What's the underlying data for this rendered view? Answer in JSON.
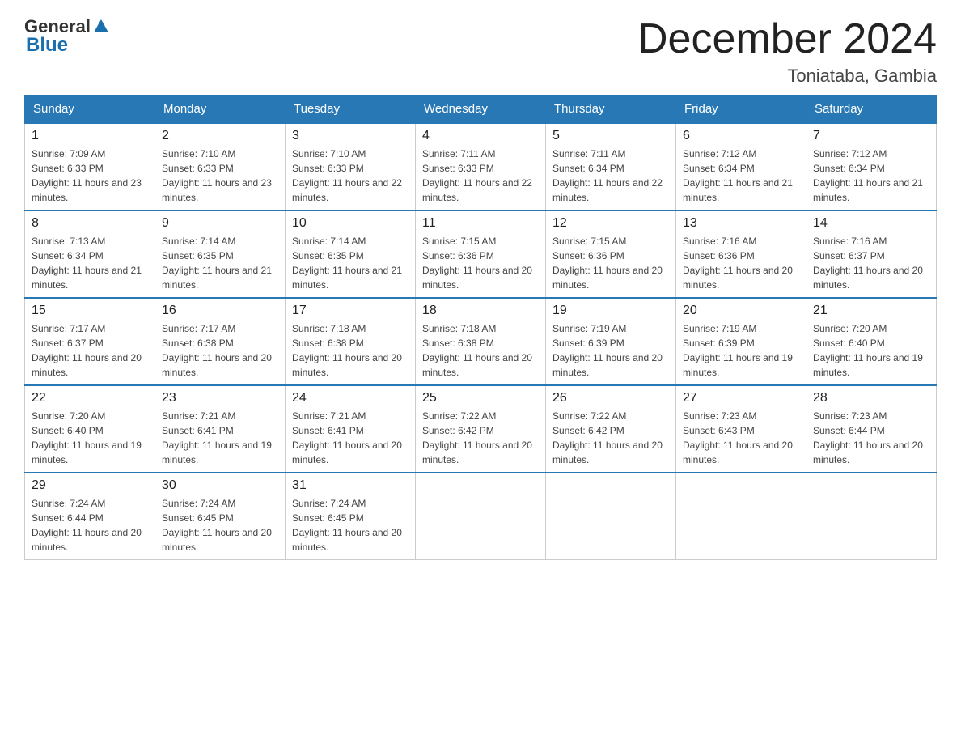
{
  "header": {
    "logo_text_general": "General",
    "logo_text_blue": "Blue",
    "month_title": "December 2024",
    "location": "Toniataba, Gambia"
  },
  "days_of_week": [
    "Sunday",
    "Monday",
    "Tuesday",
    "Wednesday",
    "Thursday",
    "Friday",
    "Saturday"
  ],
  "weeks": [
    [
      {
        "day": "1",
        "sunrise": "7:09 AM",
        "sunset": "6:33 PM",
        "daylight": "11 hours and 23 minutes."
      },
      {
        "day": "2",
        "sunrise": "7:10 AM",
        "sunset": "6:33 PM",
        "daylight": "11 hours and 23 minutes."
      },
      {
        "day": "3",
        "sunrise": "7:10 AM",
        "sunset": "6:33 PM",
        "daylight": "11 hours and 22 minutes."
      },
      {
        "day": "4",
        "sunrise": "7:11 AM",
        "sunset": "6:33 PM",
        "daylight": "11 hours and 22 minutes."
      },
      {
        "day": "5",
        "sunrise": "7:11 AM",
        "sunset": "6:34 PM",
        "daylight": "11 hours and 22 minutes."
      },
      {
        "day": "6",
        "sunrise": "7:12 AM",
        "sunset": "6:34 PM",
        "daylight": "11 hours and 21 minutes."
      },
      {
        "day": "7",
        "sunrise": "7:12 AM",
        "sunset": "6:34 PM",
        "daylight": "11 hours and 21 minutes."
      }
    ],
    [
      {
        "day": "8",
        "sunrise": "7:13 AM",
        "sunset": "6:34 PM",
        "daylight": "11 hours and 21 minutes."
      },
      {
        "day": "9",
        "sunrise": "7:14 AM",
        "sunset": "6:35 PM",
        "daylight": "11 hours and 21 minutes."
      },
      {
        "day": "10",
        "sunrise": "7:14 AM",
        "sunset": "6:35 PM",
        "daylight": "11 hours and 21 minutes."
      },
      {
        "day": "11",
        "sunrise": "7:15 AM",
        "sunset": "6:36 PM",
        "daylight": "11 hours and 20 minutes."
      },
      {
        "day": "12",
        "sunrise": "7:15 AM",
        "sunset": "6:36 PM",
        "daylight": "11 hours and 20 minutes."
      },
      {
        "day": "13",
        "sunrise": "7:16 AM",
        "sunset": "6:36 PM",
        "daylight": "11 hours and 20 minutes."
      },
      {
        "day": "14",
        "sunrise": "7:16 AM",
        "sunset": "6:37 PM",
        "daylight": "11 hours and 20 minutes."
      }
    ],
    [
      {
        "day": "15",
        "sunrise": "7:17 AM",
        "sunset": "6:37 PM",
        "daylight": "11 hours and 20 minutes."
      },
      {
        "day": "16",
        "sunrise": "7:17 AM",
        "sunset": "6:38 PM",
        "daylight": "11 hours and 20 minutes."
      },
      {
        "day": "17",
        "sunrise": "7:18 AM",
        "sunset": "6:38 PM",
        "daylight": "11 hours and 20 minutes."
      },
      {
        "day": "18",
        "sunrise": "7:18 AM",
        "sunset": "6:38 PM",
        "daylight": "11 hours and 20 minutes."
      },
      {
        "day": "19",
        "sunrise": "7:19 AM",
        "sunset": "6:39 PM",
        "daylight": "11 hours and 20 minutes."
      },
      {
        "day": "20",
        "sunrise": "7:19 AM",
        "sunset": "6:39 PM",
        "daylight": "11 hours and 19 minutes."
      },
      {
        "day": "21",
        "sunrise": "7:20 AM",
        "sunset": "6:40 PM",
        "daylight": "11 hours and 19 minutes."
      }
    ],
    [
      {
        "day": "22",
        "sunrise": "7:20 AM",
        "sunset": "6:40 PM",
        "daylight": "11 hours and 19 minutes."
      },
      {
        "day": "23",
        "sunrise": "7:21 AM",
        "sunset": "6:41 PM",
        "daylight": "11 hours and 19 minutes."
      },
      {
        "day": "24",
        "sunrise": "7:21 AM",
        "sunset": "6:41 PM",
        "daylight": "11 hours and 20 minutes."
      },
      {
        "day": "25",
        "sunrise": "7:22 AM",
        "sunset": "6:42 PM",
        "daylight": "11 hours and 20 minutes."
      },
      {
        "day": "26",
        "sunrise": "7:22 AM",
        "sunset": "6:42 PM",
        "daylight": "11 hours and 20 minutes."
      },
      {
        "day": "27",
        "sunrise": "7:23 AM",
        "sunset": "6:43 PM",
        "daylight": "11 hours and 20 minutes."
      },
      {
        "day": "28",
        "sunrise": "7:23 AM",
        "sunset": "6:44 PM",
        "daylight": "11 hours and 20 minutes."
      }
    ],
    [
      {
        "day": "29",
        "sunrise": "7:24 AM",
        "sunset": "6:44 PM",
        "daylight": "11 hours and 20 minutes."
      },
      {
        "day": "30",
        "sunrise": "7:24 AM",
        "sunset": "6:45 PM",
        "daylight": "11 hours and 20 minutes."
      },
      {
        "day": "31",
        "sunrise": "7:24 AM",
        "sunset": "6:45 PM",
        "daylight": "11 hours and 20 minutes."
      },
      null,
      null,
      null,
      null
    ]
  ],
  "labels": {
    "sunrise": "Sunrise: ",
    "sunset": "Sunset: ",
    "daylight": "Daylight: "
  }
}
